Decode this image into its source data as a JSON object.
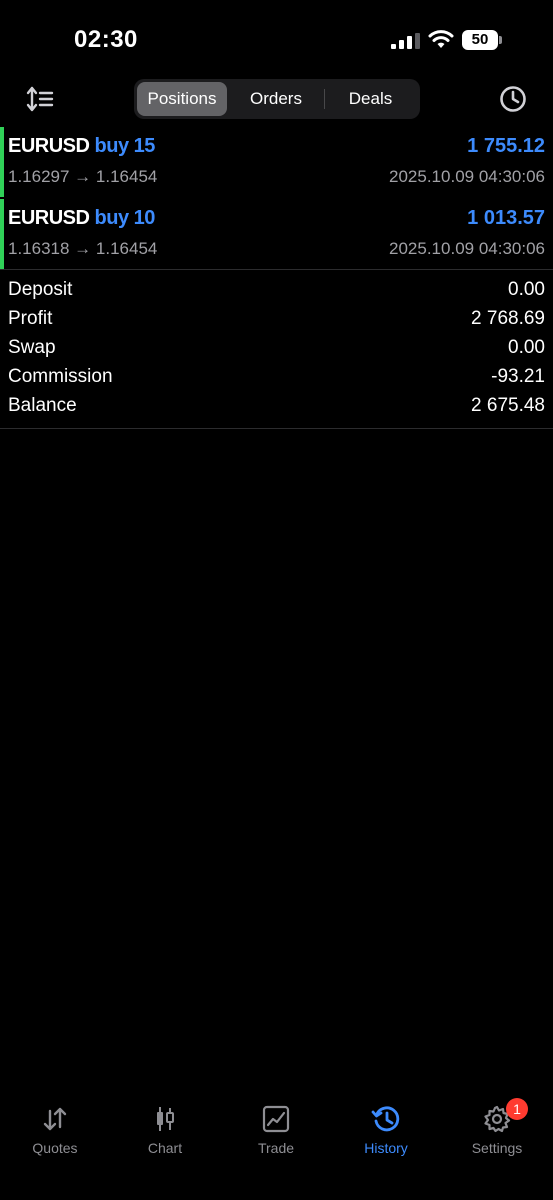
{
  "status_bar": {
    "time": "02:30",
    "battery": "50"
  },
  "toolbar": {
    "segments": [
      "Positions",
      "Orders",
      "Deals"
    ],
    "selected_segment": "Positions"
  },
  "positions": [
    {
      "symbol": "EURUSD",
      "side": "buy 15",
      "profit": "1 755.12",
      "prices": "1.16297 → 1.16454",
      "time": "2025.10.09 04:30:06"
    },
    {
      "symbol": "EURUSD",
      "side": "buy 10",
      "profit": "1 013.57",
      "prices": "1.16318 → 1.16454",
      "time": "2025.10.09 04:30:06"
    }
  ],
  "summary": [
    {
      "label": "Deposit",
      "value": "0.00"
    },
    {
      "label": "Profit",
      "value": "2 768.69"
    },
    {
      "label": "Swap",
      "value": "0.00"
    },
    {
      "label": "Commission",
      "value": "-93.21"
    },
    {
      "label": "Balance",
      "value": "2 675.48"
    }
  ],
  "tabbar": {
    "tabs": [
      {
        "label": "Quotes",
        "icon": "quotes-arrows-icon"
      },
      {
        "label": "Chart",
        "icon": "candlestick-icon"
      },
      {
        "label": "Trade",
        "icon": "trade-chart-icon"
      },
      {
        "label": "History",
        "icon": "history-clock-icon"
      },
      {
        "label": "Settings",
        "icon": "gear-icon"
      }
    ],
    "active": "History",
    "settings_badge": "1"
  },
  "colors": {
    "accent_blue": "#3d8bfd",
    "buy_green": "#30d158",
    "badge_red": "#ff3b30"
  }
}
